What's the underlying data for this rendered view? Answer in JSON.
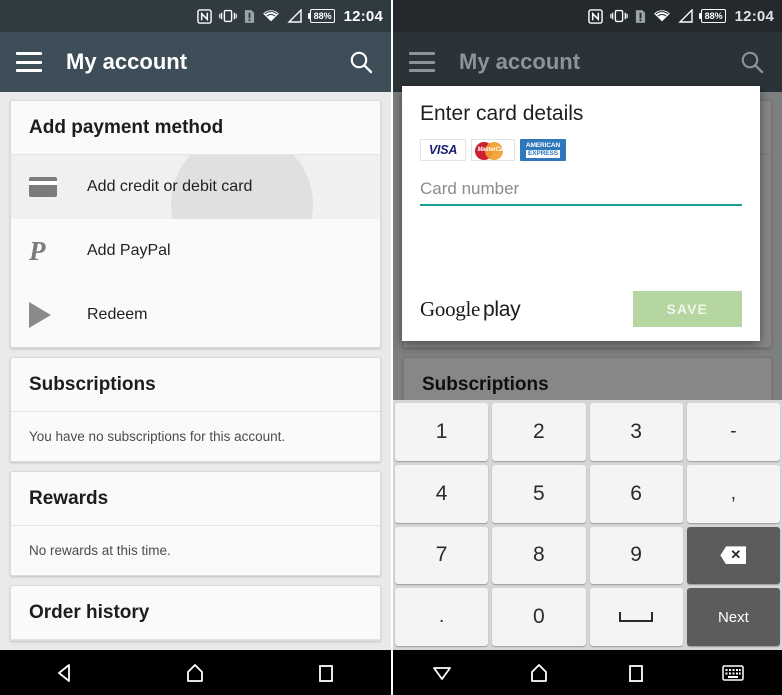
{
  "status_bar": {
    "icons": [
      "nfc-icon",
      "vibrate-icon",
      "sim-alert-icon",
      "wifi-icon",
      "signal-icon"
    ],
    "battery_percent": "88%",
    "clock": "12:04"
  },
  "app_bar": {
    "menu_icon": "hamburger-menu-icon",
    "title": "My account",
    "search_icon": "search-icon"
  },
  "left_screen": {
    "payment_card": {
      "header": "Add payment method",
      "rows": [
        {
          "icon": "credit-card-icon",
          "label": "Add credit or debit card",
          "pressed": true
        },
        {
          "icon": "paypal-icon",
          "label": "Add PayPal",
          "pressed": false
        },
        {
          "icon": "play-redeem-icon",
          "label": "Redeem",
          "pressed": false
        }
      ]
    },
    "subscriptions_card": {
      "header": "Subscriptions",
      "note": "You have no subscriptions for this account."
    },
    "rewards_card": {
      "header": "Rewards",
      "note": "No rewards at this time."
    },
    "order_history_card": {
      "header": "Order history"
    }
  },
  "right_screen": {
    "dialog": {
      "title": "Enter card details",
      "brands": [
        {
          "name": "visa-logo",
          "text": "VISA"
        },
        {
          "name": "mastercard-logo",
          "text": "MasterCard"
        },
        {
          "name": "amex-logo",
          "line1": "AMERICAN",
          "line2": "EXPRESS"
        }
      ],
      "card_number_placeholder": "Card number",
      "card_number_value": "",
      "brand_logo": {
        "google": "Google",
        "play": "play"
      },
      "save_label": "SAVE",
      "accent_color": "#1a9e8f",
      "save_button_color": "#b5d6a0"
    },
    "background_card_header": "Subscriptions",
    "keyboard": {
      "rows": [
        [
          {
            "label": "1",
            "name": "key-1",
            "style": "light"
          },
          {
            "label": "2",
            "name": "key-2",
            "style": "light"
          },
          {
            "label": "3",
            "name": "key-3",
            "style": "light"
          },
          {
            "label": "-",
            "name": "key-dash",
            "style": "light"
          }
        ],
        [
          {
            "label": "4",
            "name": "key-4",
            "style": "light"
          },
          {
            "label": "5",
            "name": "key-5",
            "style": "light"
          },
          {
            "label": "6",
            "name": "key-6",
            "style": "light"
          },
          {
            "label": ",",
            "name": "key-comma",
            "style": "light"
          }
        ],
        [
          {
            "label": "7",
            "name": "key-7",
            "style": "light"
          },
          {
            "label": "8",
            "name": "key-8",
            "style": "light"
          },
          {
            "label": "9",
            "name": "key-9",
            "style": "light"
          },
          {
            "label": "",
            "name": "key-backspace",
            "style": "dark"
          }
        ],
        [
          {
            "label": ".",
            "name": "key-period",
            "style": "light"
          },
          {
            "label": "0",
            "name": "key-0",
            "style": "light"
          },
          {
            "label": "",
            "name": "key-space",
            "style": "light"
          },
          {
            "label": "Next",
            "name": "key-next",
            "style": "dark"
          }
        ]
      ]
    }
  },
  "nav_bar_left": {
    "back_icon": "back-triangle-icon",
    "home_icon": "home-icon",
    "recents_icon": "recents-square-icon"
  },
  "nav_bar_right": {
    "back_icon": "dismiss-keyboard-down-triangle-icon",
    "home_icon": "home-icon",
    "recents_icon": "recents-square-icon",
    "keyboard_icon": "keyboard-icon"
  },
  "colors": {
    "app_bar": "#3e4e58",
    "status_bar": "#2f3a41",
    "page_background": "#e8eaec",
    "accent_teal": "#1a9e8f"
  }
}
